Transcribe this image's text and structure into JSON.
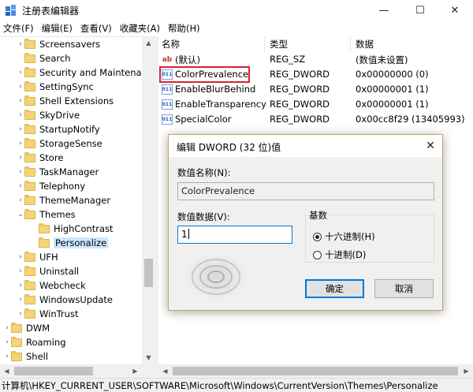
{
  "window": {
    "title": "注册表编辑器",
    "min_glyph": "—",
    "max_glyph": "☐",
    "close_glyph": "✕"
  },
  "menu": [
    "文件(F)",
    "编辑(E)",
    "查看(V)",
    "收藏夹(A)",
    "帮助(H)"
  ],
  "tree": {
    "items": [
      {
        "label": "Screensavers",
        "arrow": "›",
        "level": 2
      },
      {
        "label": "Search",
        "arrow": "",
        "level": 2
      },
      {
        "label": "Security and Maintenance",
        "arrow": "›",
        "level": 2
      },
      {
        "label": "SettingSync",
        "arrow": "›",
        "level": 2
      },
      {
        "label": "Shell Extensions",
        "arrow": "›",
        "level": 2
      },
      {
        "label": "SkyDrive",
        "arrow": "›",
        "level": 2
      },
      {
        "label": "StartupNotify",
        "arrow": "›",
        "level": 2
      },
      {
        "label": "StorageSense",
        "arrow": "›",
        "level": 2
      },
      {
        "label": "Store",
        "arrow": "›",
        "level": 2
      },
      {
        "label": "TaskManager",
        "arrow": "›",
        "level": 2
      },
      {
        "label": "Telephony",
        "arrow": "›",
        "level": 2
      },
      {
        "label": "ThemeManager",
        "arrow": "›",
        "level": 2
      },
      {
        "label": "Themes",
        "arrow": "⌄",
        "level": 2
      },
      {
        "label": "HighContrast",
        "arrow": "",
        "level": 3
      },
      {
        "label": "Personalize",
        "arrow": "",
        "level": 3,
        "selected": true
      },
      {
        "label": "UFH",
        "arrow": "›",
        "level": 2
      },
      {
        "label": "Uninstall",
        "arrow": "›",
        "level": 2
      },
      {
        "label": "Webcheck",
        "arrow": "›",
        "level": 2
      },
      {
        "label": "WindowsUpdate",
        "arrow": "›",
        "level": 2
      },
      {
        "label": "WinTrust",
        "arrow": "›",
        "level": 2
      },
      {
        "label": "DWM",
        "arrow": "›",
        "level": 1
      },
      {
        "label": "Roaming",
        "arrow": "›",
        "level": 1
      },
      {
        "label": "Shell",
        "arrow": "›",
        "level": 1
      }
    ]
  },
  "values": {
    "headers": {
      "name": "名称",
      "type": "类型",
      "data": "数据"
    },
    "rows": [
      {
        "icon": "ab",
        "name": "(默认)",
        "type": "REG_SZ",
        "data": "(数值未设置)"
      },
      {
        "icon": "dw",
        "name": "ColorPrevalence",
        "type": "REG_DWORD",
        "data": "0x00000000 (0)"
      },
      {
        "icon": "dw",
        "name": "EnableBlurBehind",
        "type": "REG_DWORD",
        "data": "0x00000001 (1)"
      },
      {
        "icon": "dw",
        "name": "EnableTransparency",
        "type": "REG_DWORD",
        "data": "0x00000001 (1)"
      },
      {
        "icon": "dw",
        "name": "SpecialColor",
        "type": "REG_DWORD",
        "data": "0x00cc8f29 (13405993)"
      }
    ]
  },
  "dialog": {
    "title": "编辑 DWORD (32 位)值",
    "close_glyph": "✕",
    "name_label": "数值名称(N):",
    "name_value": "ColorPrevalence",
    "data_label": "数值数据(V):",
    "data_value": "1",
    "base_label": "基数",
    "hex_label": "十六进制(H)",
    "dec_label": "十进制(D)",
    "ok_label": "确定",
    "cancel_label": "取消"
  },
  "statusbar": {
    "path": "计算机\\HKEY_CURRENT_USER\\SOFTWARE\\Microsoft\\Windows\\CurrentVersion\\Themes\\Personalize"
  },
  "colors": {
    "highlight_box": "#d9232e",
    "selection": "#cce8ff",
    "accent": "#0078d7",
    "folder": "#f3d477"
  }
}
